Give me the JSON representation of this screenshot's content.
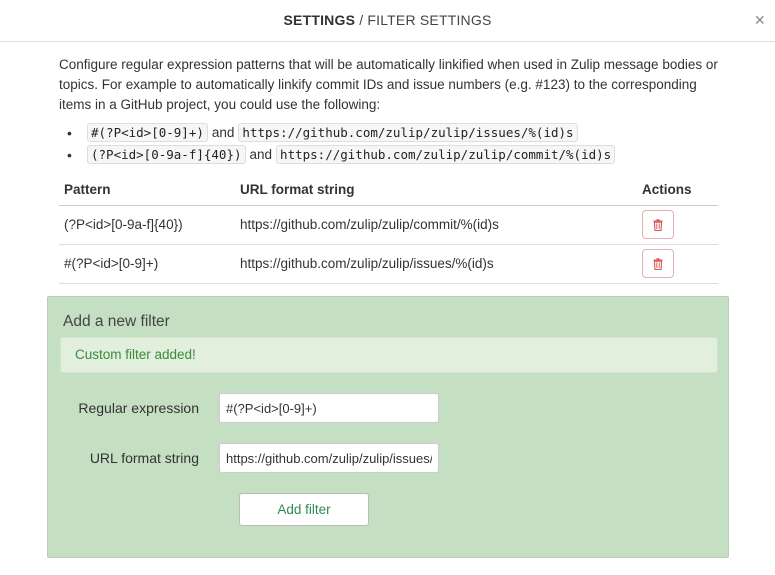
{
  "header": {
    "section": "SETTINGS",
    "separator": " / ",
    "page": "FILTER SETTINGS",
    "close_glyph": "×"
  },
  "intro": {
    "text": "Configure regular expression patterns that will be automatically linkified when used in Zulip message bodies or topics. For example to automatically linkify commit IDs and issue numbers (e.g. #123) to the corresponding items in a GitHub project, you could use the following:",
    "examples": [
      {
        "pattern": "#(?P<id>[0-9]+)",
        "joiner": "and",
        "url": "https://github.com/zulip/zulip/issues/%(id)s"
      },
      {
        "pattern": "(?P<id>[0-9a-f]{40})",
        "joiner": "and",
        "url": "https://github.com/zulip/zulip/commit/%(id)s"
      }
    ]
  },
  "table": {
    "headers": {
      "pattern": "Pattern",
      "url": "URL format string",
      "actions": "Actions"
    },
    "rows": [
      {
        "pattern": "(?P<id>[0-9a-f]{40})",
        "url": "https://github.com/zulip/zulip/commit/%(id)s",
        "action_icon": "trash-icon"
      },
      {
        "pattern": "#(?P<id>[0-9]+)",
        "url": "https://github.com/zulip/zulip/issues/%(id)s",
        "action_icon": "trash-icon"
      }
    ]
  },
  "add_filter": {
    "title": "Add a new filter",
    "alert": "Custom filter added!",
    "regex_label": "Regular expression",
    "regex_value": "#(?P<id>[0-9]+)",
    "url_label": "URL format string",
    "url_value": "https://github.com/zulip/zulip/issues/%(id)s",
    "submit_label": "Add filter"
  },
  "colors": {
    "panel_bg": "#c5dfc3",
    "alert_text": "#3c8a3c",
    "delete_icon": "#d9534f",
    "submit_text": "#2d8a55"
  }
}
